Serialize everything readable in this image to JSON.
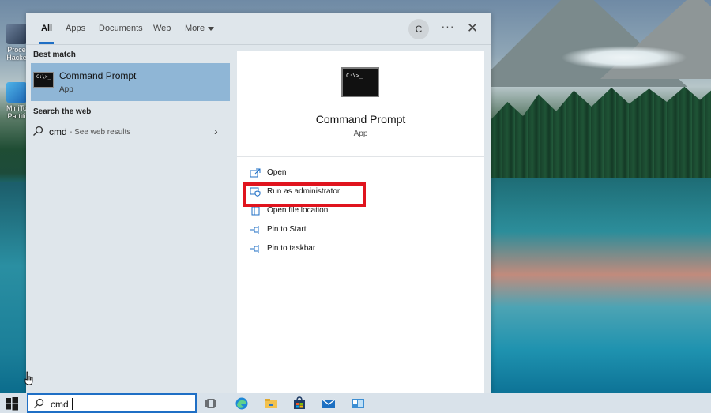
{
  "desktop": {
    "icons": [
      {
        "label": "Proce\nHacke"
      },
      {
        "label": "MiniTo\nPartiti"
      }
    ]
  },
  "search_panel": {
    "tabs": [
      {
        "label": "All",
        "active": true
      },
      {
        "label": "Apps"
      },
      {
        "label": "Documents"
      },
      {
        "label": "Web"
      },
      {
        "label": "More"
      }
    ],
    "account_initial": "C",
    "more_options_label": "···",
    "close_label": "✕",
    "best_match": {
      "heading": "Best match",
      "name": "Command Prompt",
      "type": "App"
    },
    "web": {
      "heading": "Search the web",
      "query": "cmd",
      "sub": "- See web results"
    },
    "detail": {
      "title": "Command Prompt",
      "subtitle": "App",
      "actions": [
        {
          "label": "Open",
          "icon": "open-icon"
        },
        {
          "label": "Run as administrator",
          "icon": "shield-icon"
        },
        {
          "label": "Open file location",
          "icon": "folder-icon"
        },
        {
          "label": "Pin to Start",
          "icon": "pin-icon"
        },
        {
          "label": "Pin to taskbar",
          "icon": "pin-icon"
        }
      ]
    }
  },
  "taskbar": {
    "search_text": "cmd",
    "apps": [
      "task-view-icon",
      "edge-icon",
      "file-explorer-icon",
      "store-icon",
      "mail-icon",
      "app-icon"
    ]
  },
  "colors": {
    "accent": "#1f6fc5",
    "highlight": "#e0141e",
    "selected_bg": "#8fb6d6"
  }
}
